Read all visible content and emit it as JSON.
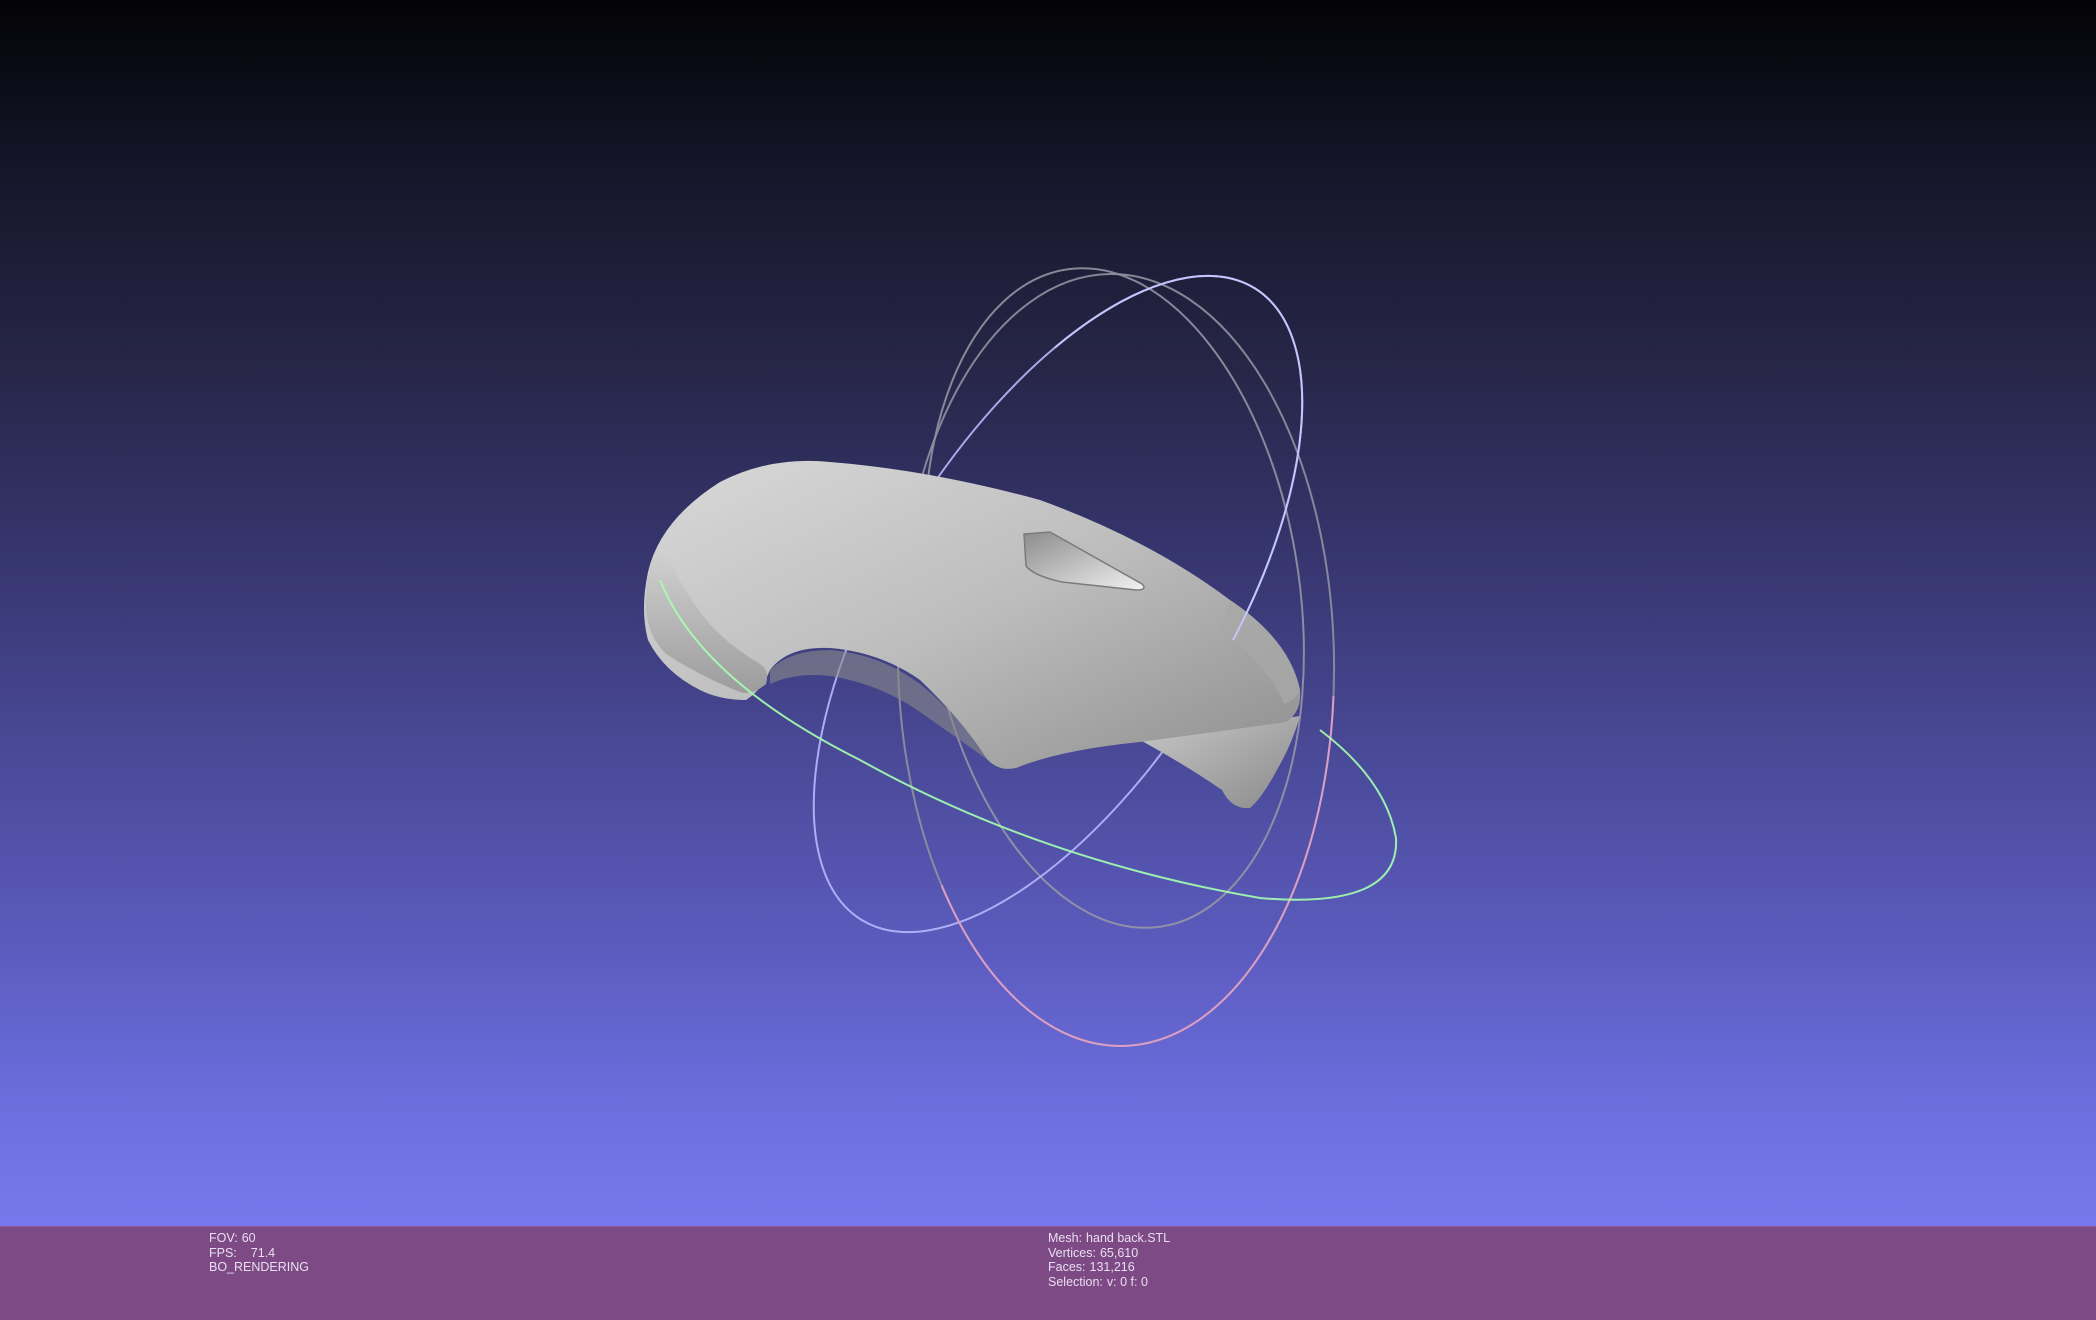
{
  "window": {
    "app": "MeshLab 3D viewport"
  },
  "viewport": {
    "background_top": "#030306",
    "background_bottom": "#7878ec",
    "mesh_color": "#c4c4c4",
    "trackball": {
      "x_ring_color": "#e6a0c8",
      "y_ring_color": "#a6ffb0",
      "z_ring_color": "#b8b8ff",
      "outer_ring_color": "#9a9aa8"
    }
  },
  "status_bar": {
    "background": "#7e4a86",
    "left": {
      "fov_label": "FOV:",
      "fov_value": "60",
      "fps_label": "FPS:",
      "fps_value": "71.4",
      "render_mode": "BO_RENDERING"
    },
    "right": {
      "mesh_label": "Mesh:",
      "mesh_value": "hand back.STL",
      "vertices_label": "Vertices:",
      "vertices_value": "65,610",
      "faces_label": "Faces:",
      "faces_value": "131,216",
      "selection_label": "Selection:",
      "selection_value": "v: 0 f: 0"
    }
  }
}
